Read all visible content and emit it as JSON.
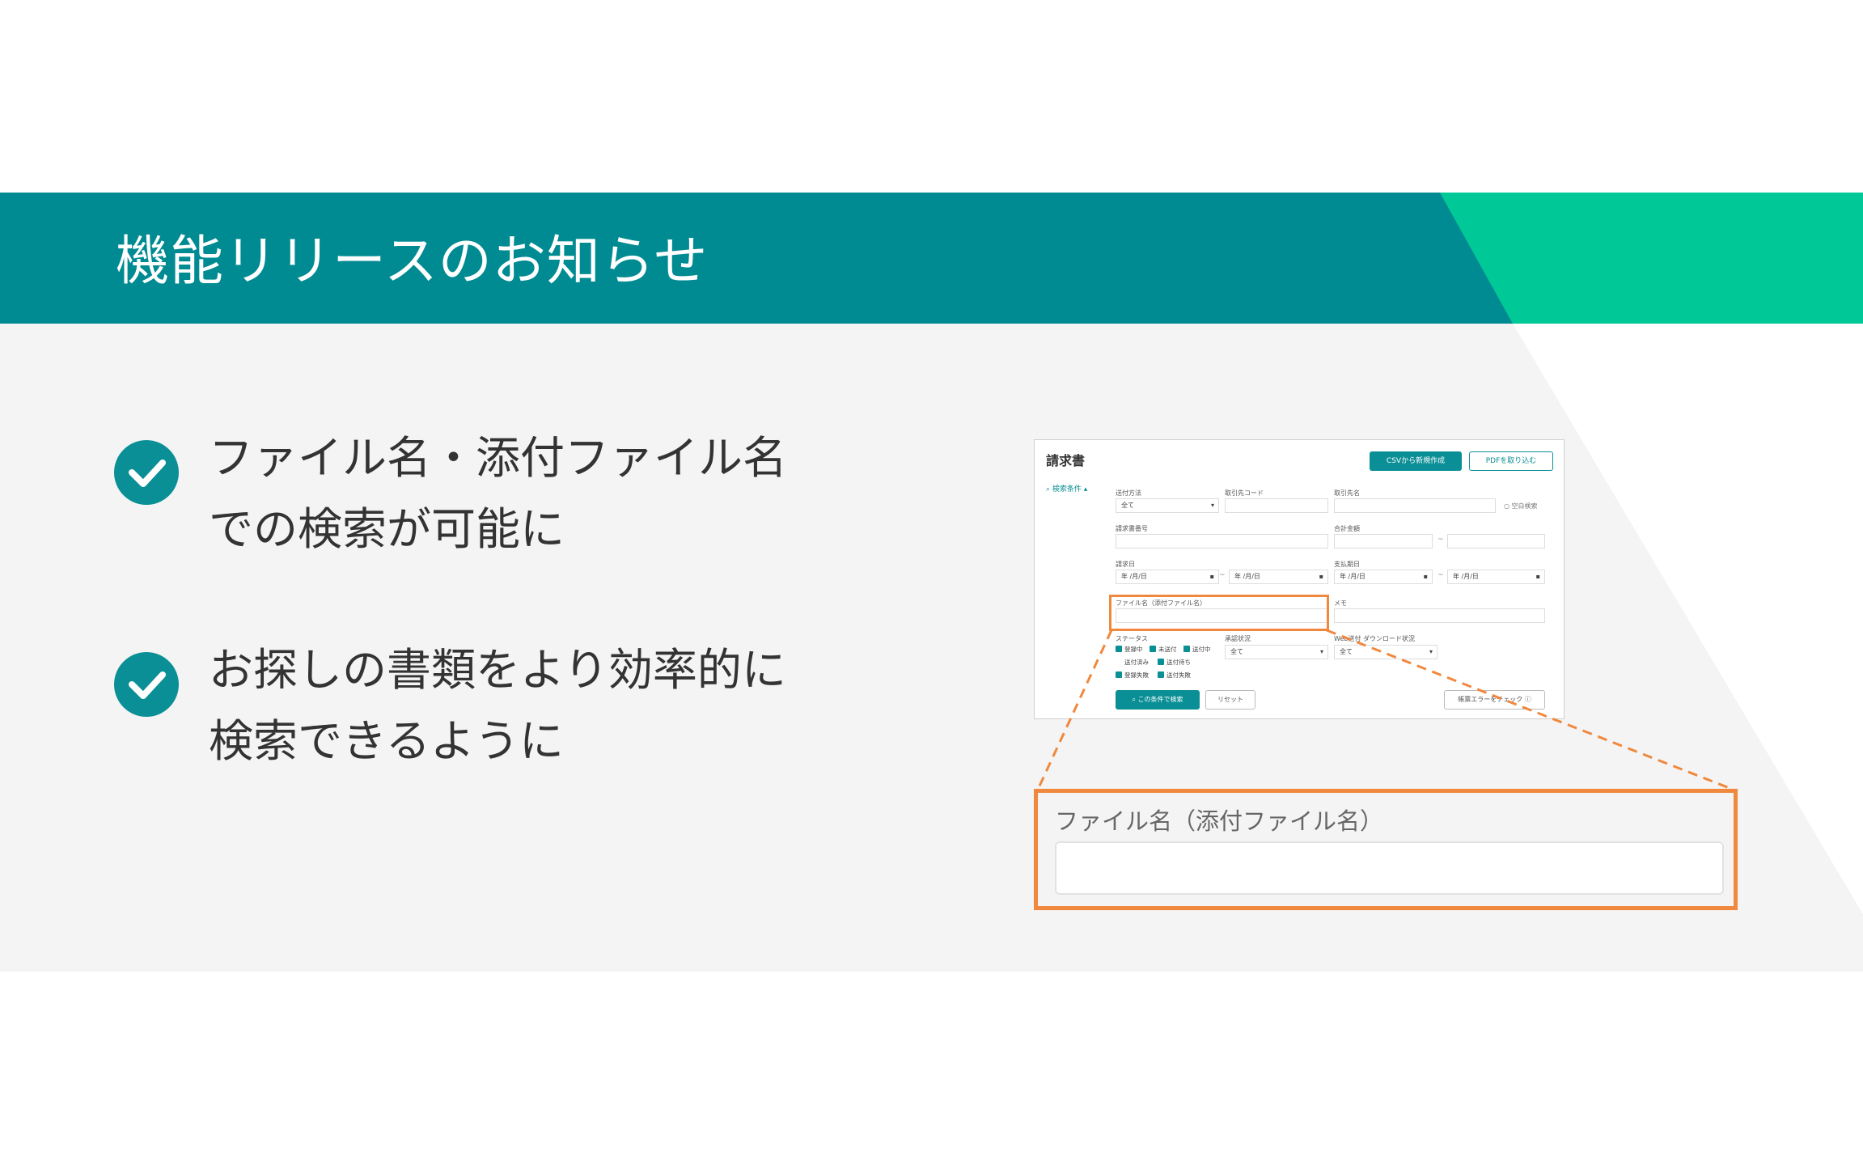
{
  "header": {
    "title": "機能リリースのお知らせ"
  },
  "features": [
    {
      "icon": "check-circle-icon",
      "line1": "ファイル名・添付ファイル名",
      "line2": "での検索が可能に"
    },
    {
      "icon": "check-circle-icon",
      "line1": "お探しの書類をより効率的に",
      "line2": "検索できるように"
    }
  ],
  "screenshot": {
    "title": "請求書",
    "csv_button": "CSVから新規作成",
    "pdf_button": "PDFを取り込む",
    "search_conditions": "検索条件",
    "fields": {
      "send_method_label": "送付方法",
      "send_method_value": "全て",
      "partner_code_label": "取引先コード",
      "partner_name_label": "取引先名",
      "blank_search": "空白検索",
      "invoice_no_label": "請求書番号",
      "total_label": "合計金額",
      "invoice_date_label": "請求日",
      "date_placeholder": "年 /月/日",
      "due_date_label": "支払期日",
      "file_name_label": "ファイル名（添付ファイル名）",
      "memo_label": "メモ",
      "status_label": "ステータス",
      "approval_label": "承認状況",
      "approval_value": "全て",
      "web_download_label": "Web送付 ダウンロード状況",
      "web_download_value": "全て"
    },
    "statuses": [
      "登録中",
      "未送付",
      "送付中",
      "送付済み",
      "送付待ち",
      "登録失敗",
      "送付失敗"
    ],
    "search_button": "この条件で検索",
    "reset_button": "リセット",
    "error_button": "帳票エラーをチェック"
  },
  "zoom": {
    "label": "ファイル名（添付ファイル名）",
    "input_value": ""
  },
  "colors": {
    "teal": "#008b92",
    "green": "#00c896",
    "orange": "#f0883e",
    "check": "#0b8f96"
  }
}
